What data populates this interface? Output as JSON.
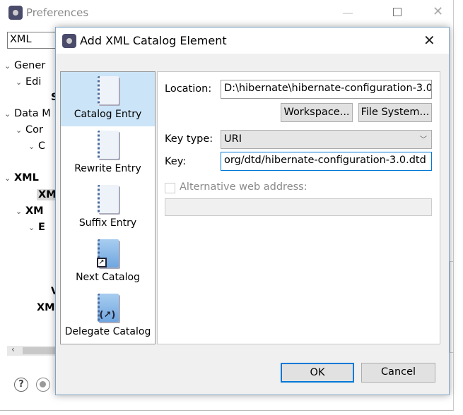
{
  "preferences": {
    "title": "Preferences",
    "filter_value": "XML",
    "tree": [
      {
        "label": "Gener",
        "bold": false
      },
      {
        "label": "Edi",
        "bold": false
      },
      {
        "label": "S",
        "bold": true
      },
      {
        "label": "Data M",
        "bold": false
      },
      {
        "label": "Cor",
        "bold": false
      },
      {
        "label": "C",
        "bold": false
      },
      {
        "label": "XML",
        "bold": true
      },
      {
        "label": "XM",
        "bold": true
      },
      {
        "label": "XM",
        "bold": true
      },
      {
        "label": "E",
        "bold": true
      },
      {
        "label": "V",
        "bold": true
      },
      {
        "label": "XM",
        "bold": true
      }
    ]
  },
  "dialog": {
    "title": "Add XML Catalog Element",
    "entry_types": [
      {
        "label": "Catalog Entry",
        "icon": "catalog-entry-icon",
        "selected": true
      },
      {
        "label": "Rewrite Entry",
        "icon": "rewrite-entry-icon"
      },
      {
        "label": "Suffix Entry",
        "icon": "suffix-entry-icon"
      },
      {
        "label": "Next Catalog",
        "icon": "next-catalog-icon"
      },
      {
        "label": "Delegate Catalog",
        "icon": "delegate-catalog-icon"
      }
    ],
    "location_label": "Location:",
    "location_value": "D:\\hibernate\\hibernate-configuration-3.0",
    "workspace_button": "Workspace...",
    "file_system_button": "File System...",
    "key_type_label": "Key type:",
    "key_type_value": "URI",
    "key_label": "Key:",
    "key_value": "org/dtd/hibernate-configuration-3.0.dtd",
    "alt_web_label": "Alternative web address:",
    "alt_web_checked": false,
    "ok_button": "OK",
    "cancel_button": "Cancel",
    "accent": "#0078d7",
    "selection": "#cce4f7"
  }
}
